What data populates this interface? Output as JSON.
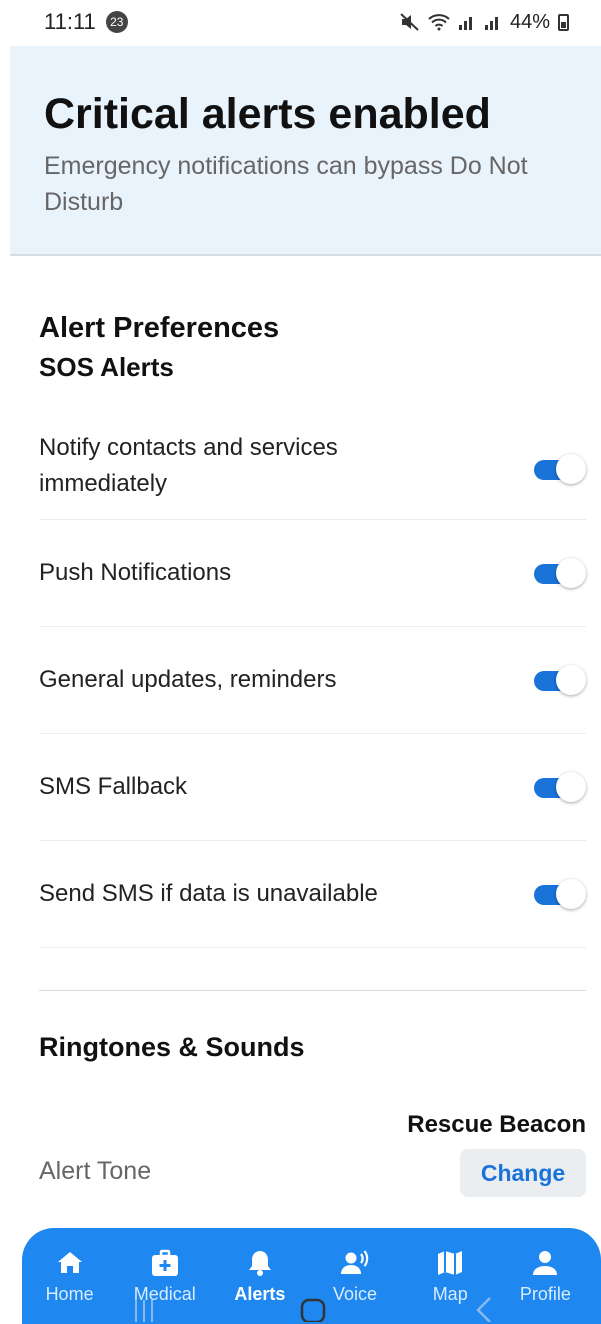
{
  "status_bar": {
    "time": "11:11",
    "notification_count": "23",
    "battery": "44%"
  },
  "banner": {
    "title": "Critical alerts enabled",
    "subtitle": "Emergency notifications can bypass Do Not Disturb"
  },
  "alert_preferences": {
    "title": "Alert Preferences",
    "subtitle": "SOS Alerts",
    "items": [
      {
        "label": "Notify contacts and services immediately",
        "enabled": true
      },
      {
        "label": "Push Notifications",
        "enabled": true
      },
      {
        "label": "General updates, reminders",
        "enabled": true
      },
      {
        "label": "SMS Fallback",
        "enabled": true
      },
      {
        "label": "Send SMS if data is unavailable",
        "enabled": true
      }
    ]
  },
  "ringtones": {
    "title": "Ringtones & Sounds",
    "alert_tone_label": "Alert Tone",
    "alert_tone_value": "Rescue Beacon",
    "change_label": "Change"
  },
  "bottom_nav": {
    "items": [
      {
        "label": "Home",
        "icon": "home-icon",
        "active": false
      },
      {
        "label": "Medical",
        "icon": "medical-kit-icon",
        "active": false
      },
      {
        "label": "Alerts",
        "icon": "bell-icon",
        "active": true
      },
      {
        "label": "Voice",
        "icon": "voice-icon",
        "active": false
      },
      {
        "label": "Map",
        "icon": "map-icon",
        "active": false
      },
      {
        "label": "Profile",
        "icon": "person-icon",
        "active": false
      }
    ]
  },
  "colors": {
    "accent": "#1a73d9",
    "nav_background": "#1e88f0",
    "banner_background": "#e9f3fc"
  }
}
